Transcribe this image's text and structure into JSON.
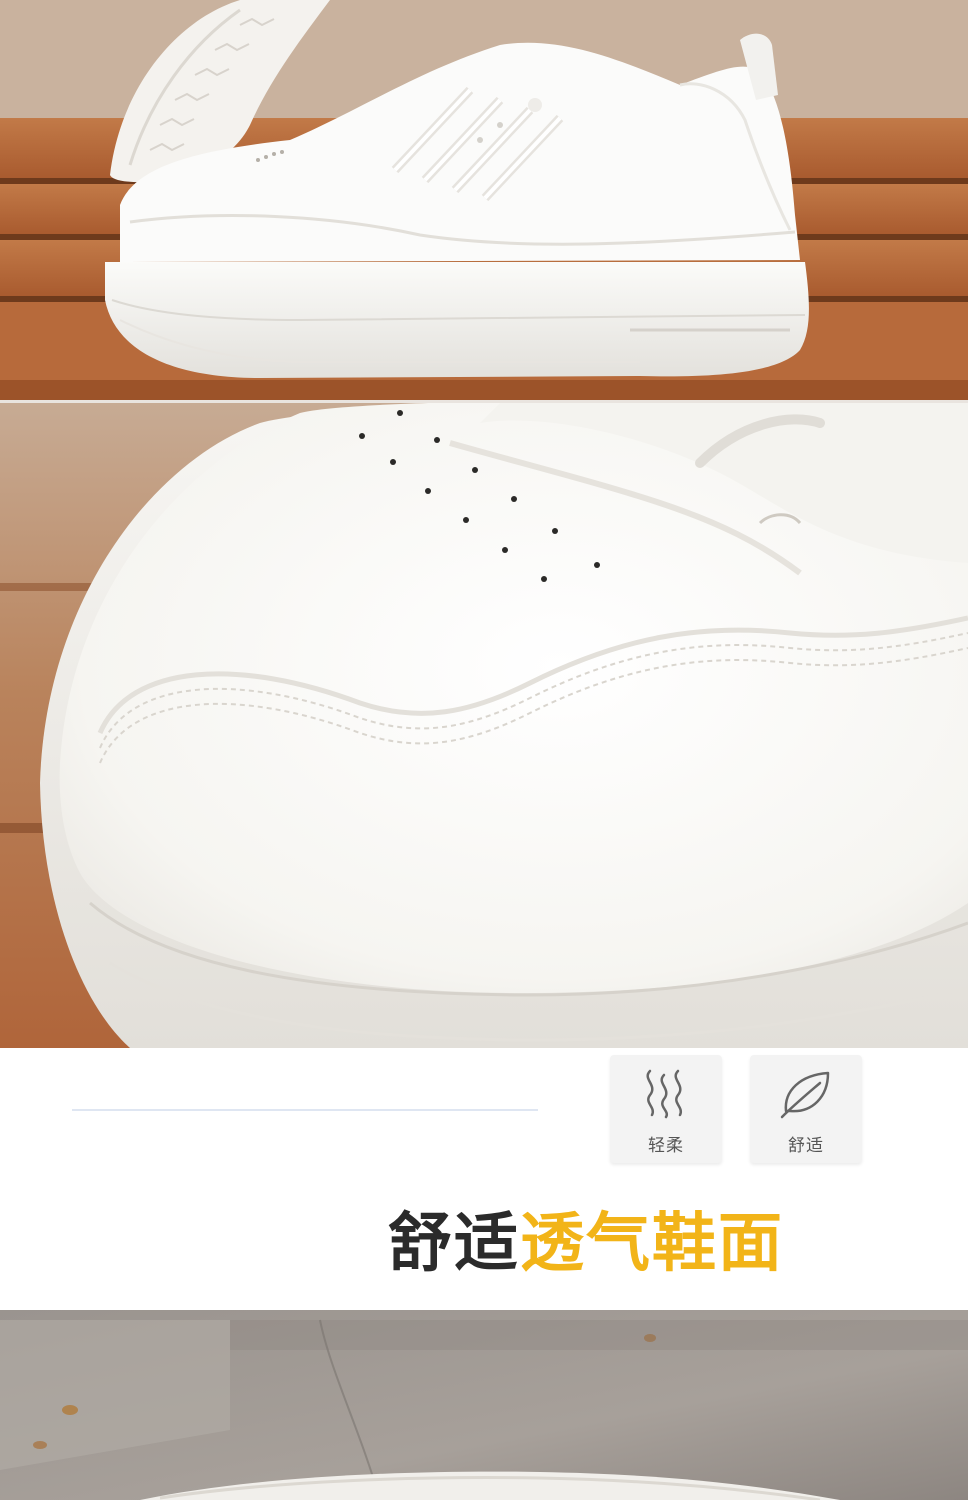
{
  "feature_badges": [
    {
      "icon": "airflow-waves-icon",
      "label": "轻柔"
    },
    {
      "icon": "leaf-icon",
      "label": "舒适"
    }
  ],
  "headline": {
    "dark_text": "舒适",
    "accent_text": "透气鞋面"
  },
  "colors": {
    "accent": "#f2b418",
    "headline_dark": "#2b2b2b",
    "wood": "#b4683a"
  }
}
